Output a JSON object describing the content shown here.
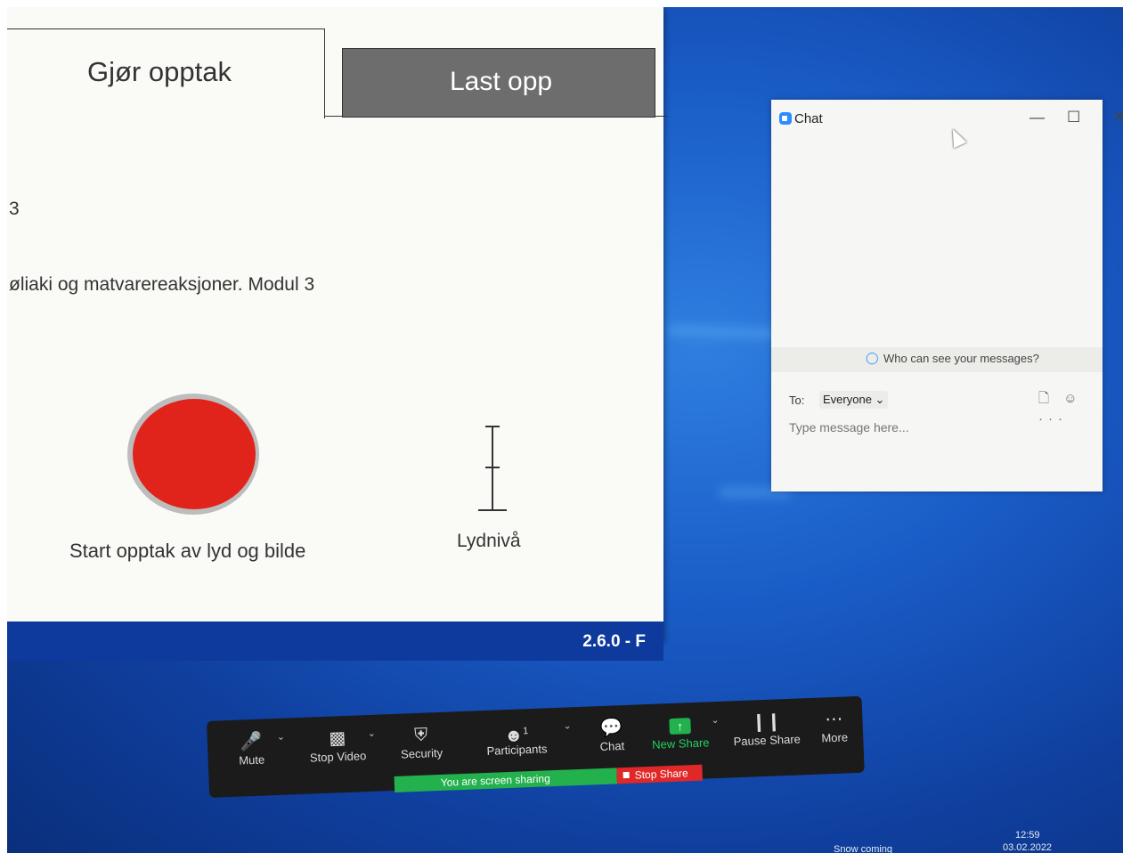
{
  "app": {
    "tab_record": "Gjør opptak",
    "tab_upload": "Last opp",
    "module_number": "3",
    "module_title": "øliaki og matvarereaksjoner. Modul 3",
    "record_label": "Start opptak av lyd og bilde",
    "meter_label": "Lydnivå",
    "version": "2.6.0 - F"
  },
  "chat": {
    "title": "Chat",
    "minimize": "—",
    "maximize": "☐",
    "close": "✕",
    "who_can_see": "Who can see your messages?",
    "to_label": "To:",
    "to_value": "Everyone ⌄",
    "icons": "🗋 ☺ ···",
    "input_placeholder": "Type message here..."
  },
  "toolbar": {
    "mute": "Mute",
    "stop_video": "Stop Video",
    "security": "Security",
    "participants": "Participants",
    "participants_count": "1",
    "chat": "Chat",
    "new_share": "New Share",
    "pause_share": "Pause Share",
    "more": "More",
    "sharing_banner": "You are screen sharing",
    "stop_share": "Stop Share"
  },
  "taskbar": {
    "news": "Snow coming",
    "time": "12:59",
    "date": "03.02.2022"
  },
  "colors": {
    "record_red": "#e0241b",
    "share_green": "#23b14d",
    "stop_red": "#e02828",
    "desktop_blue": "#1a5dc8"
  }
}
